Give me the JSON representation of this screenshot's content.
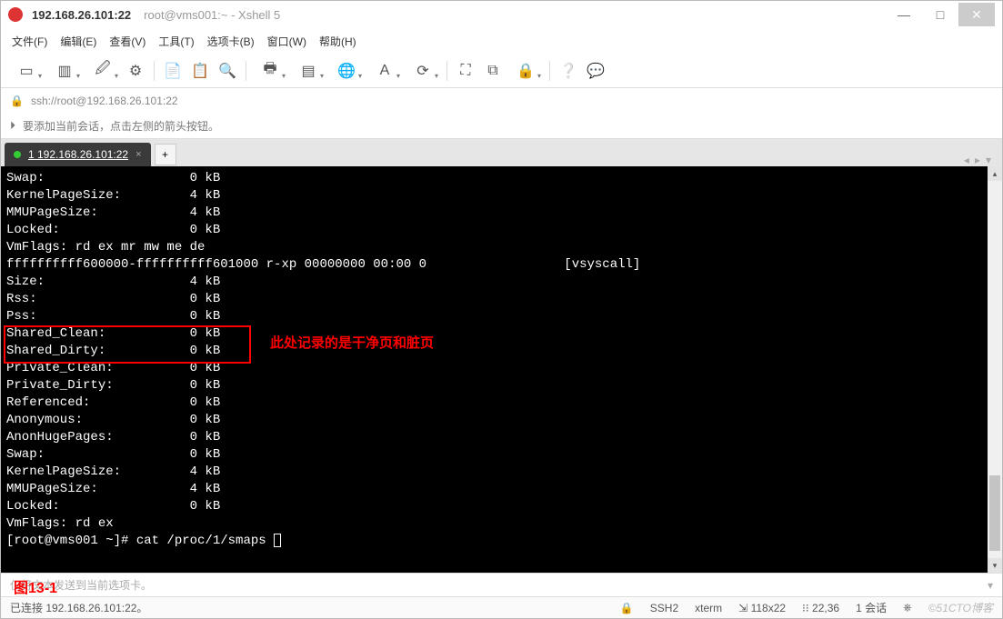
{
  "title": {
    "address": "192.168.26.101:22",
    "subtitle": "root@vms001:~ - Xshell 5"
  },
  "winbtns": {
    "min": "—",
    "max": "□",
    "close": "✕"
  },
  "menu": {
    "file": "文件(F)",
    "edit": "编辑(E)",
    "view": "查看(V)",
    "tools": "工具(T)",
    "tabs": "选项卡(B)",
    "window": "窗口(W)",
    "help": "帮助(H)"
  },
  "urlbar": {
    "lock": "🔒",
    "url": "ssh://root@192.168.26.101:22"
  },
  "tip": {
    "icon": "⏵",
    "text": "要添加当前会话，点击左侧的箭头按钮。"
  },
  "tab": {
    "label": "1 192.168.26.101:22",
    "close": "×",
    "add": "+",
    "nav_left": "◂",
    "nav_right": "▸",
    "nav_menu": "▾"
  },
  "annotation": "此处记录的是干净页和脏页",
  "figure_label": {
    "prefix": "图",
    "num": "13-1"
  },
  "terminal": {
    "lines": [
      {
        "k": "Swap:",
        "v": "0 kB"
      },
      {
        "k": "KernelPageSize:",
        "v": "4 kB"
      },
      {
        "k": "MMUPageSize:",
        "v": "4 kB"
      },
      {
        "k": "Locked:",
        "v": "0 kB"
      },
      {
        "raw": "VmFlags: rd ex mr mw me de"
      },
      {
        "raw": "ffffffffff600000-ffffffffff601000 r-xp 00000000 00:00 0                  [vsyscall]"
      },
      {
        "k": "Size:",
        "v": "4 kB"
      },
      {
        "k": "Rss:",
        "v": "0 kB"
      },
      {
        "k": "Pss:",
        "v": "0 kB"
      },
      {
        "k": "Shared_Clean:",
        "v": "0 kB"
      },
      {
        "k": "Shared_Dirty:",
        "v": "0 kB"
      },
      {
        "k": "Private_Clean:",
        "v": "0 kB"
      },
      {
        "k": "Private_Dirty:",
        "v": "0 kB"
      },
      {
        "k": "Referenced:",
        "v": "0 kB"
      },
      {
        "k": "Anonymous:",
        "v": "0 kB"
      },
      {
        "k": "AnonHugePages:",
        "v": "0 kB"
      },
      {
        "k": "Swap:",
        "v": "0 kB"
      },
      {
        "k": "KernelPageSize:",
        "v": "4 kB"
      },
      {
        "k": "MMUPageSize:",
        "v": "4 kB"
      },
      {
        "k": "Locked:",
        "v": "0 kB"
      },
      {
        "raw": "VmFlags: rd ex"
      }
    ],
    "prompt": "[root@vms001 ~]# cat /proc/1/smaps "
  },
  "sendbar": {
    "placeholder": "仅将文本发送到当前选项卡。",
    "dropdown": "▾"
  },
  "status": {
    "connected": "已连接 192.168.26.101:22。",
    "ssh": "SSH2",
    "term": "xterm",
    "size": "118x22",
    "pos": "22,36",
    "sessions": "1 会话",
    "watermark": "©51CTO博客",
    "icons": {
      "lock": "🔒",
      "dim": "⇲",
      "cur": "⁝⁝",
      "caps": "⎈"
    }
  },
  "toolbar_icons": {
    "new": "▭",
    "open": "▥",
    "props": "🖉",
    "gear": "⚙",
    "copy": "📄",
    "paste": "📋",
    "find": "🔍",
    "print": "🖶",
    "color": "▤",
    "encode": "🌐",
    "font": "A",
    "style": "⟳",
    "full": "⛶",
    "layout": "⧉",
    "lock": "🔒",
    "help": "❔",
    "chat": "💬",
    "sep": "|"
  }
}
